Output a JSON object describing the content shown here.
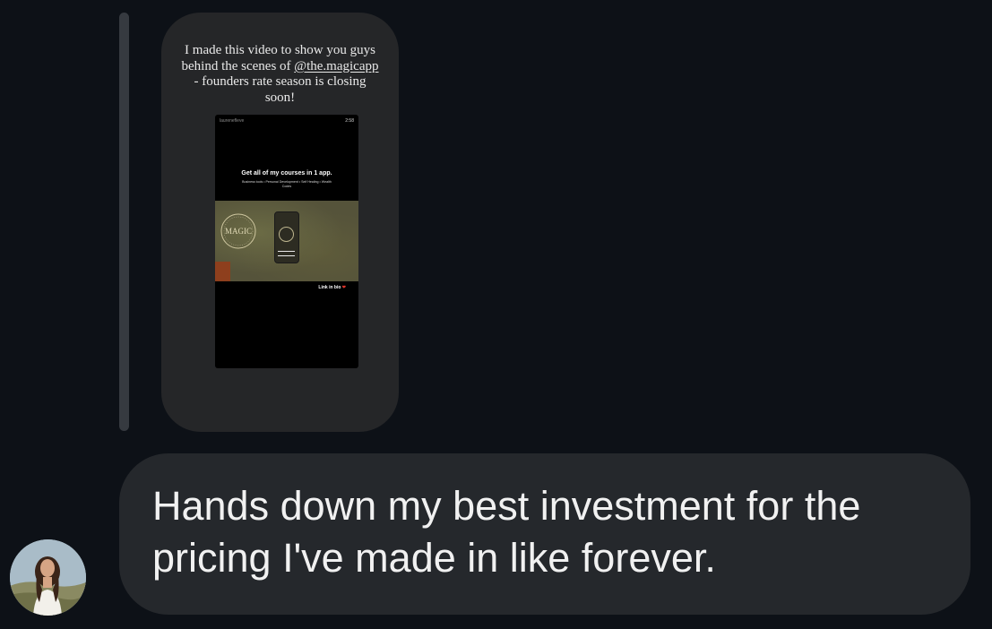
{
  "story_reply": {
    "caption": {
      "line1": "I made this video to show you guys behind the scenes of",
      "mention": "@the.magicapp",
      "line2": " - founders rate season is closing soon!"
    },
    "video": {
      "username": "laurenefleve",
      "time": "2:58",
      "headline": "Get all of my courses in 1 app.",
      "subtext": "Business tools • Personal Development • Self Healing • Wealth Codes",
      "logo_text": "MAGIC",
      "link_text": "Link in bio",
      "heart_icon": "heart-icon"
    }
  },
  "message": {
    "text": "Hands down my best investment for the\npricing I've made in like forever."
  },
  "colors": {
    "background": "#0d1117",
    "bubble": "#25282c",
    "story_card": "#252628",
    "reply_bar": "#363a40",
    "heart": "#e0352b"
  }
}
